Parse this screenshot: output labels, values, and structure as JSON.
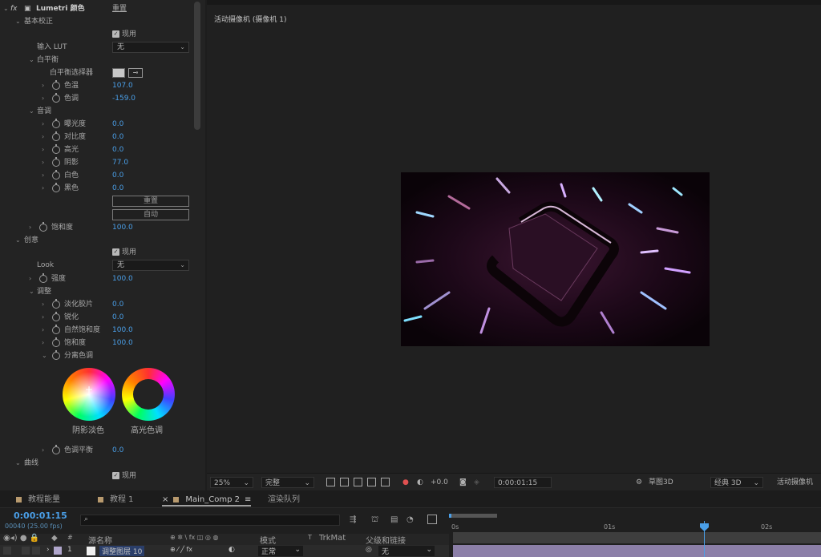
{
  "effect_panel": {
    "effect_name": "Lumetri 颜色",
    "reset_link": "重置",
    "sections": {
      "basic": "基本校正",
      "white_balance": "白平衡",
      "tone": "音调",
      "creative": "创意",
      "adjust": "调整",
      "split_tone": "分离色调",
      "curves": "曲线"
    },
    "enable_label": "现用",
    "input_lut_label": "输入 LUT",
    "input_lut_value": "无",
    "wb_picker_label": "白平衡选择器",
    "temp_label": "色温",
    "temp_value": "107.0",
    "tint_label": "色调",
    "tint_value": "-159.0",
    "exposure_label": "曝光度",
    "exposure_value": "0.0",
    "contrast_label": "对比度",
    "contrast_value": "0.0",
    "highlights_label": "高光",
    "highlights_value": "0.0",
    "shadows_label": "阴影",
    "shadows_value": "77.0",
    "whites_label": "白色",
    "whites_value": "0.0",
    "blacks_label": "黑色",
    "blacks_value": "0.0",
    "reset_button": "重置",
    "auto_button": "自动",
    "saturation_label": "饱和度",
    "saturation_value": "100.0",
    "look_label": "Look",
    "look_value": "无",
    "intensity_label": "强度",
    "intensity_value": "100.0",
    "faded_film_label": "淡化胶片",
    "faded_film_value": "0.0",
    "sharpen_label": "锐化",
    "sharpen_value": "0.0",
    "vibrance_label": "自然饱和度",
    "vibrance_value": "100.0",
    "saturation2_label": "饱和度",
    "saturation2_value": "100.0",
    "shadow_tint_label": "阴影淡色",
    "highlight_tint_label": "高光色调",
    "tint_balance_label": "色调平衡",
    "tint_balance_value": "0.0"
  },
  "viewer": {
    "label": "活动摄像机 (摄像机 1)",
    "zoom": "25%",
    "quality": "完整",
    "exposure_value": "+0.0",
    "timecode": "0:00:01:15",
    "draft3d": "草图3D",
    "renderer": "经典 3D",
    "camera": "活动摄像机"
  },
  "timeline": {
    "tabs": [
      "教程能量",
      "教程 1",
      "Main_Comp 2",
      "渲染队列"
    ],
    "timecode": "0:00:01:15",
    "frames": "00040 (25.00 fps)",
    "ruler_ticks": [
      "0s",
      "01s",
      "02s"
    ],
    "columns": {
      "source_name": "源名称",
      "mode": "模式",
      "trkmat": "TrkMat",
      "parent": "父级和链接"
    },
    "layer": {
      "index": "1",
      "name": "调整图层 10",
      "mode": "正常",
      "parent": "无"
    }
  },
  "colors": {
    "accent": "#4a9fe8",
    "panel": "#232323",
    "layer_bar": "#8c7fa8"
  }
}
